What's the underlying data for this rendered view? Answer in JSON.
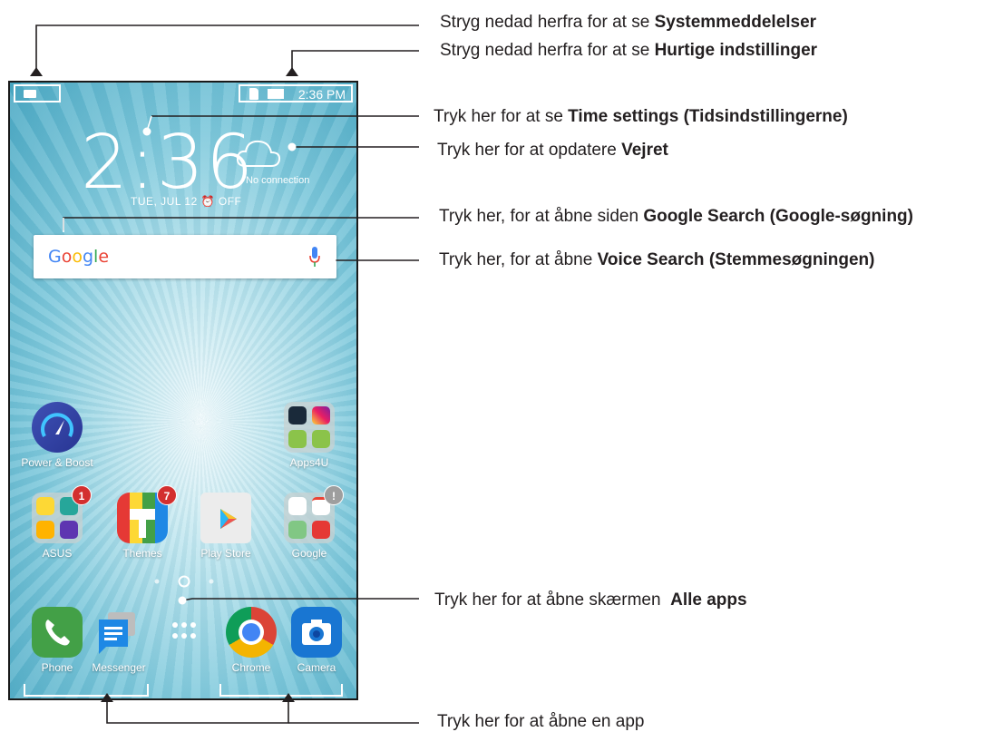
{
  "status_bar": {
    "time": "2:36 PM"
  },
  "clock_widget": {
    "time": "2:36",
    "date": "TUE, JUL 12 ⏰ OFF",
    "weather_status": "No connection"
  },
  "search_bar": {
    "logo_text": "Google"
  },
  "apps": {
    "power_boost": {
      "label": "Power & Boost"
    },
    "apps4u": {
      "label": "Apps4U"
    },
    "asus": {
      "label": "ASUS",
      "badge": "1"
    },
    "themes": {
      "label": "Themes",
      "badge": "7"
    },
    "play_store": {
      "label": "Play Store"
    },
    "google": {
      "label": "Google",
      "badge": "!"
    }
  },
  "dock": {
    "phone": {
      "label": "Phone"
    },
    "messenger": {
      "label": "Messenger"
    },
    "chrome": {
      "label": "Chrome"
    },
    "camera": {
      "label": "Camera"
    }
  },
  "callouts": {
    "notifications": {
      "text": "Stryg nedad herfra for at se ",
      "bold": "Systemmeddelelser"
    },
    "quick_settings": {
      "text": "Stryg nedad herfra for at se ",
      "bold": "Hurtige indstillinger"
    },
    "time_settings": {
      "text": "Tryk her for at se ",
      "bold": "Time settings (Tidsindstillingerne)"
    },
    "weather": {
      "text": "Tryk her for at opdatere ",
      "bold": "Vejret"
    },
    "google_search": {
      "text": "Tryk her, for at åbne siden ",
      "bold": "Google Search (Google-søgning)"
    },
    "voice_search": {
      "text": "Tryk her, for at åbne ",
      "bold": "Voice Search (Stemmesøgningen)"
    },
    "all_apps": {
      "text": "Tryk her for at åbne skærmen  ",
      "bold": "Alle apps"
    },
    "open_app": {
      "text": "Tryk her for at åbne en app",
      "bold": ""
    }
  },
  "colors": {
    "wallpaper": "#7fc9dc",
    "badge_red": "#d32f2f",
    "callout_line": "#231f20"
  },
  "icons": [
    "notification-icon",
    "sd-card-icon",
    "battery-icon",
    "cloud-icon",
    "mic-icon",
    "all-apps-icon",
    "phone-icon",
    "messenger-icon",
    "chrome-icon",
    "camera-icon",
    "play-store-icon"
  ]
}
